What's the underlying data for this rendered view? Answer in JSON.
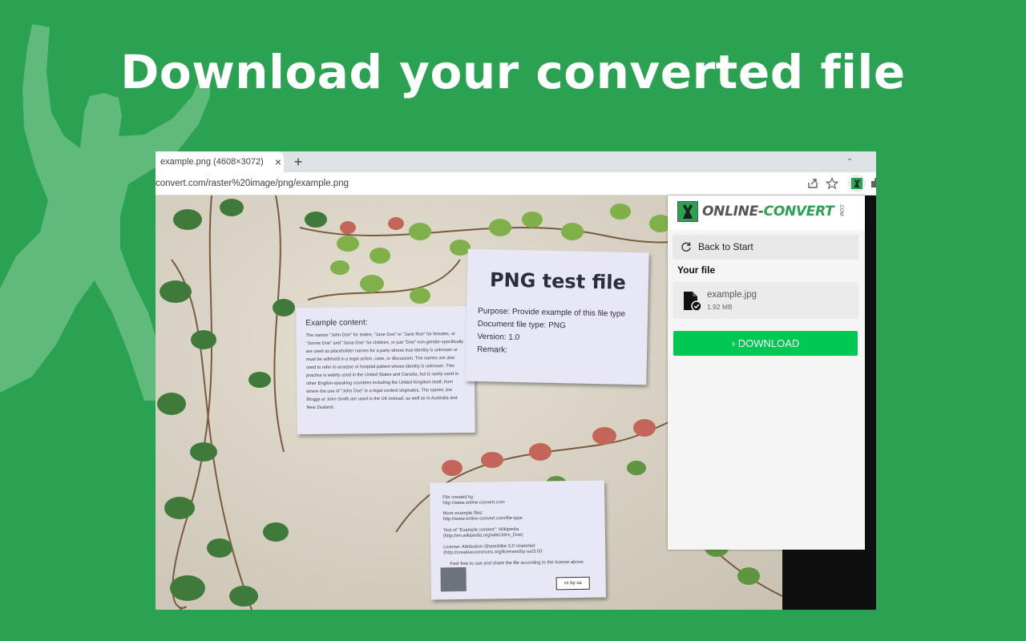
{
  "headline": "Download your converted file",
  "browser": {
    "tab_title": "example.png (4608×3072)",
    "tab_close": "×",
    "new_tab": "+",
    "url": "convert.com/raster%20image/png/example.png"
  },
  "paper_example": {
    "title": "Example content:",
    "body": "The names \"John Doe\" for males, \"Jane Doe\" or \"Jane Roe\" for females, or \"Jonnie Doe\" and \"Janie Doe\" for children, or just \"Doe\" non-gender-specifically are used as placeholder names for a party whose true identity is unknown or must be withheld in a legal action, case, or discussion. The names are also used to refer to acorpse or hospital patient whose identity is unknown. This practice is widely used in the United States and Canada, but is rarely used in other English-speaking countries including the United Kingdom itself, from where the use of \"John Doe\" in a legal context originates. The names Joe Bloggs or John Smith are used in the UK instead, as well as in Australia and New Zealand."
  },
  "paper_png": {
    "title": "PNG test file",
    "purpose": "Purpose: Provide example of this file type",
    "doctype": "Document file type: PNG",
    "version": "Version: 1.0",
    "remark": "Remark:"
  },
  "paper_source": {
    "lines": [
      "File created by:",
      "http://www.online-convert.com",
      "More example files:",
      "http://www.online-convert.com/file-type",
      "Text of \"Example content\": Wikipedia",
      "(http://en.wikipedia.org/wiki/John_Doe)",
      "License: Attribution-ShareAlike 3.0 Unported",
      "(http://creativecommons.org/licenses/by-sa/3.0/)",
      "Feel free to use and share the file according to the license above."
    ],
    "cc_badge": "cc by sa"
  },
  "panel": {
    "brand_main": "ONLINE-",
    "brand_accent": "CONVERT",
    "brand_suffix": ".COM",
    "back_label": "Back to Start",
    "your_file_label": "Your file",
    "file_name": "example.jpg",
    "file_size": "1.92 MB",
    "download_label": "› DOWNLOAD"
  },
  "colors": {
    "background": "#2ba152",
    "download_button": "#00c853"
  }
}
